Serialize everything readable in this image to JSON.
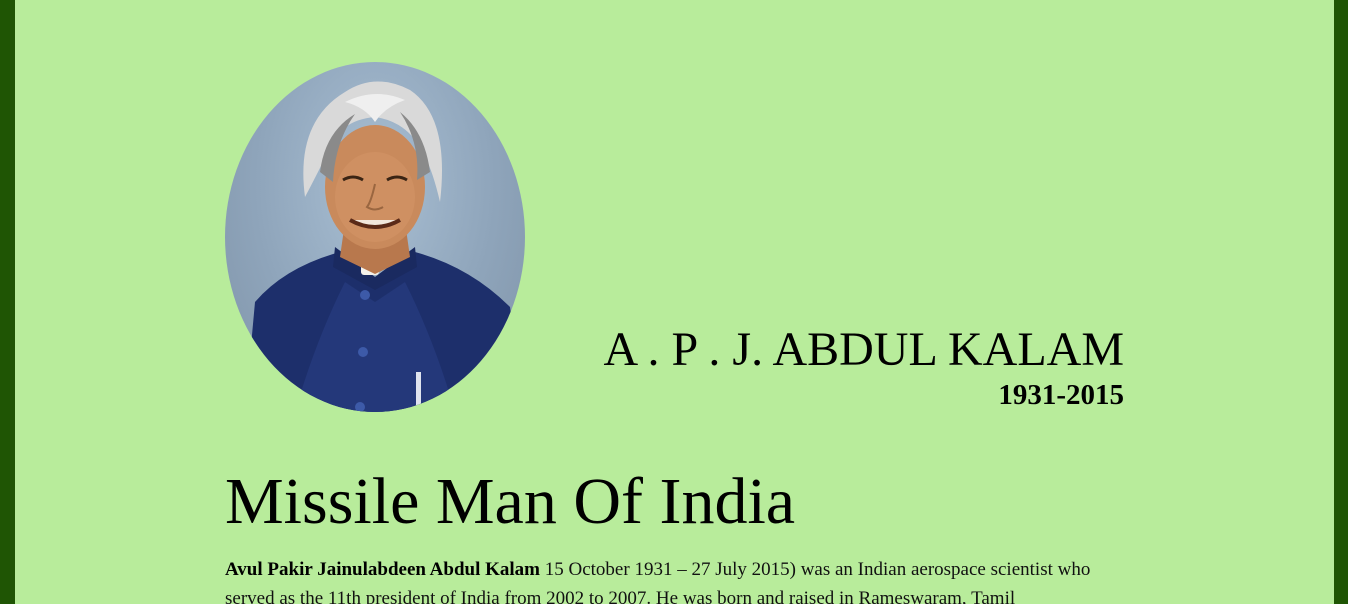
{
  "header": {
    "name": "A . P . J. ABDUL KALAM",
    "years": "1931-2015"
  },
  "main": {
    "title": "Missile Man Of India",
    "bio_bold": "Avul Pakir Jainulabdeen Abdul Kalam",
    "bio_text": " 15 October 1931 – 27 July 2015) was an Indian aerospace scientist who served as the 11th president of India from 2002 to 2007. He was born and raised in Rameswaram, Tamil"
  },
  "colors": {
    "frame": "#1f5504",
    "background": "#b8ec9b"
  }
}
